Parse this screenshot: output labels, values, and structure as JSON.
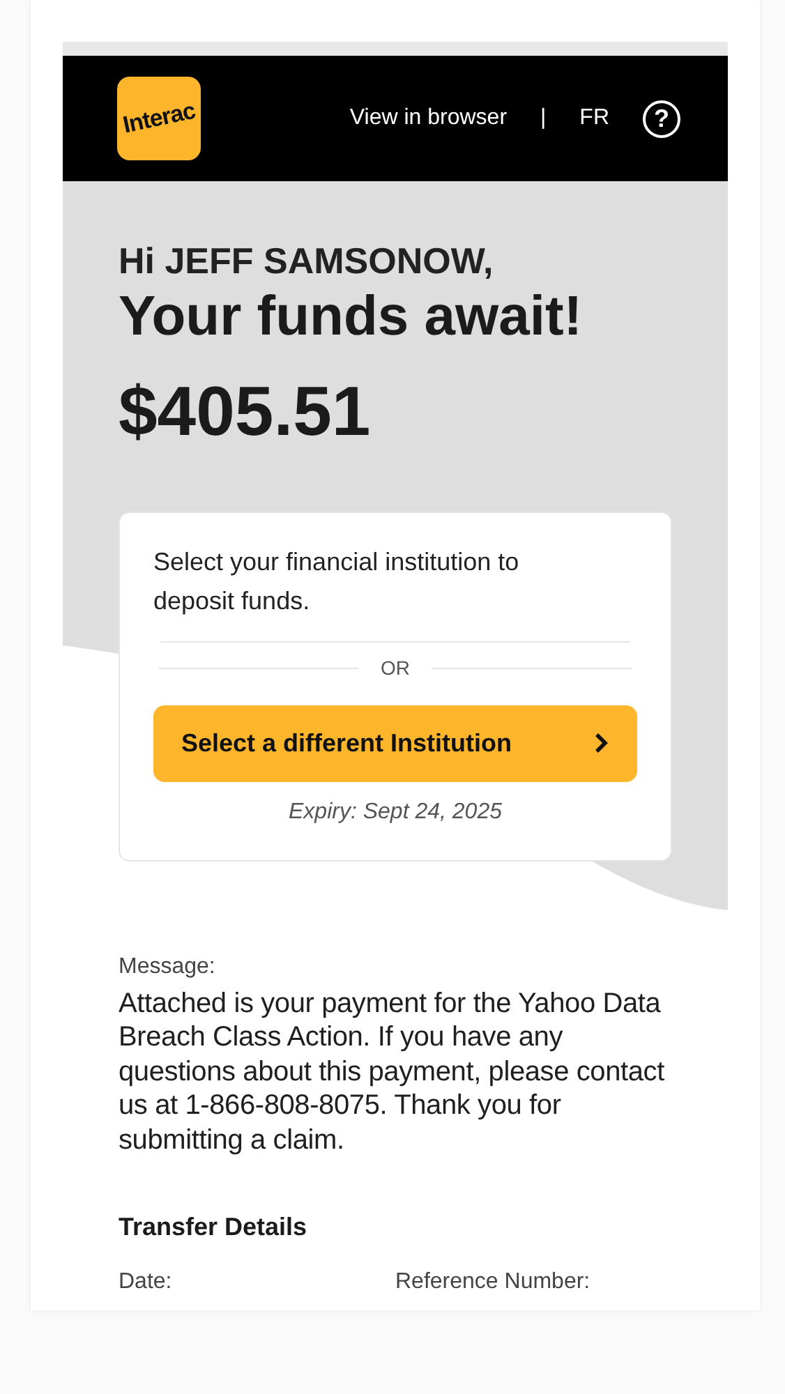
{
  "header": {
    "logo": "Interac",
    "links": [
      "View in browser",
      "FR"
    ],
    "separator": "|",
    "help_icon": "?"
  },
  "hero": {
    "greeting": "Hi JEFF SAMSONOW,",
    "headline": "Your funds await!",
    "amount": "$405.51"
  },
  "deposit_card": {
    "instruction": "Select your financial institution to deposit funds.",
    "divider_text": "OR",
    "button": "Select a different Institution",
    "expiry": "Expiry: Sept 24, 2025"
  },
  "message": {
    "label": "Message:",
    "text": "Attached is your payment for the Yahoo Data Breach Class Action. If you have any questions about this payment, please contact us at 1-866-808-8075. Thank you for submitting a claim."
  },
  "transfer_details": {
    "title": "Transfer Details",
    "fields": [
      "Date:",
      "Reference Number:"
    ]
  }
}
